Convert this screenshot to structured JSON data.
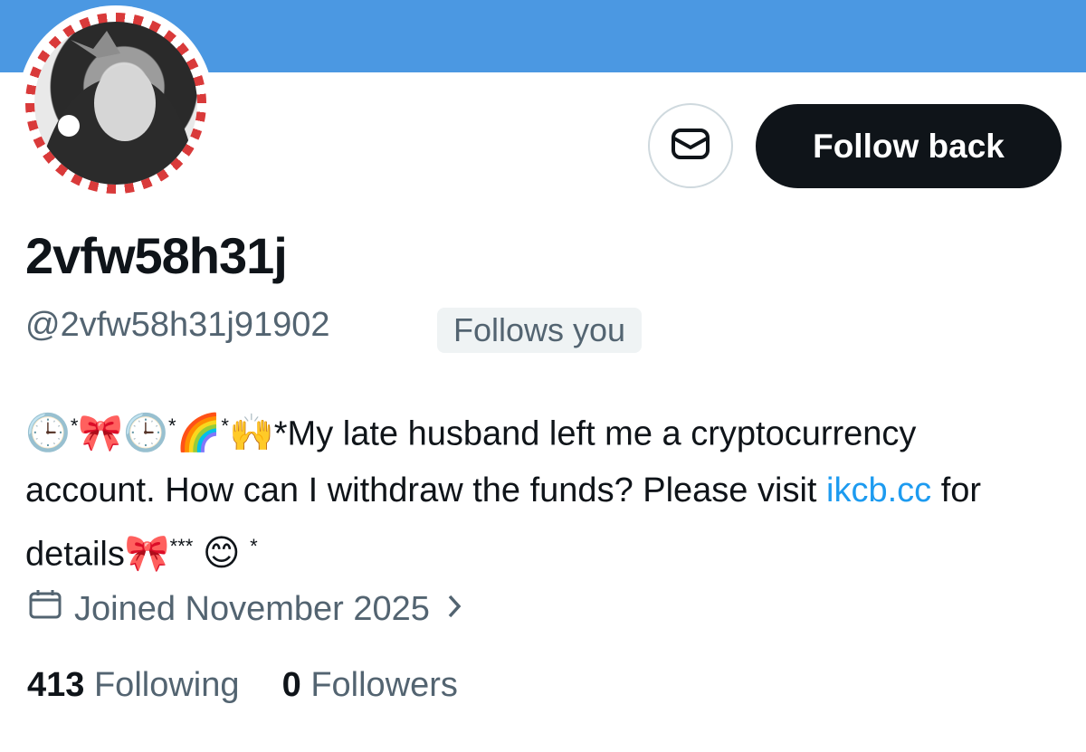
{
  "profile": {
    "display_name": "2vfw58h31j",
    "handle": "@2vfw58h31j91902",
    "follows_you_badge": "Follows you",
    "bio": {
      "emoji_prefix": [
        "🕒",
        "*",
        "🎀",
        "🕒",
        "*",
        "🌈",
        "*",
        "🙌"
      ],
      "text_before_link": "*My late husband left me a cryptocurrency account. How can I withdraw the funds? Please visit ",
      "link": "ikcb.cc",
      "text_after_link": " for details",
      "emoji_suffix": [
        "🎀",
        "***",
        "😊",
        "*"
      ]
    },
    "joined": "Joined November 2025",
    "following_count": "413",
    "following_label": "Following",
    "followers_count": "0",
    "followers_label": "Followers"
  },
  "actions": {
    "follow_back_label": "Follow back",
    "message_icon": "envelope-icon"
  },
  "colors": {
    "banner": "#4b98e2",
    "link": "#1d9bf0",
    "button_dark": "#0f1419",
    "muted": "#536471"
  }
}
